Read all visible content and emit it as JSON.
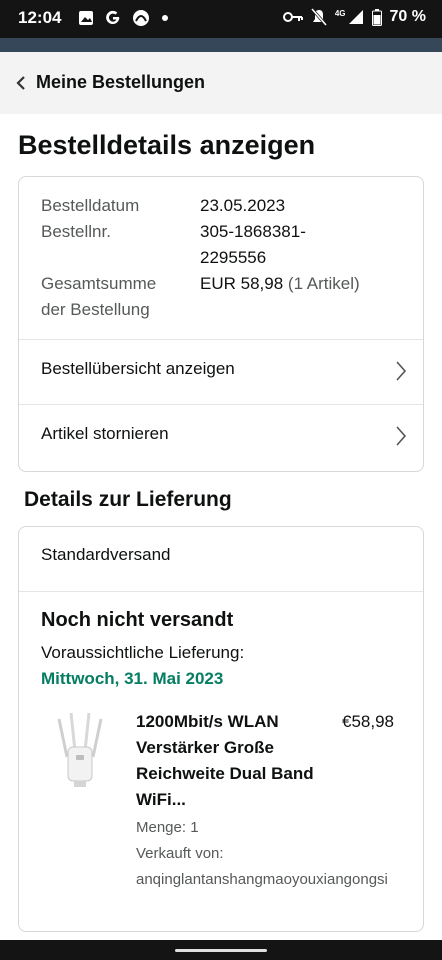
{
  "status_bar": {
    "time": "12:04",
    "network": "4G",
    "battery": "70 %",
    "icons": [
      "image-icon",
      "google-icon",
      "app-icon",
      "dot-icon",
      "vpn-key-icon",
      "mute-icon",
      "signal-icon",
      "battery-icon"
    ]
  },
  "header": {
    "back_label": "Meine Bestellungen"
  },
  "page": {
    "title": "Bestelldetails anzeigen"
  },
  "order_summary": {
    "date_label": "Bestelldatum",
    "date_value": "23.05.2023",
    "number_label": "Bestellnr.",
    "number_value_line1": "305-1868381-",
    "number_value_line2": "2295556",
    "total_label_line1": "Gesamtsumme",
    "total_label_line2": "der Bestellung",
    "total_value": "EUR 58,98",
    "total_items": "(1 Artikel)",
    "links": [
      {
        "label": "Bestellübersicht anzeigen"
      },
      {
        "label": "Artikel stornieren"
      }
    ]
  },
  "delivery": {
    "section_title": "Details zur Lieferung",
    "method": "Standardversand",
    "status": "Noch nicht versandt",
    "expected_label": "Voraussichtliche Lieferung:",
    "expected_date": "Mittwoch, 31. Mai 2023",
    "item": {
      "title": "1200Mbit/s WLAN Verstärker Große Reichweite Dual Band WiFi...",
      "price": "€58,98",
      "quantity": "Menge: 1",
      "seller_label": "Verkauft von:",
      "seller": "anqinglantanshangmaoyouxiangongsi"
    }
  },
  "colors": {
    "accent_band": "#37475a",
    "delivery_green": "#067d62",
    "status_bar": "#141414"
  }
}
